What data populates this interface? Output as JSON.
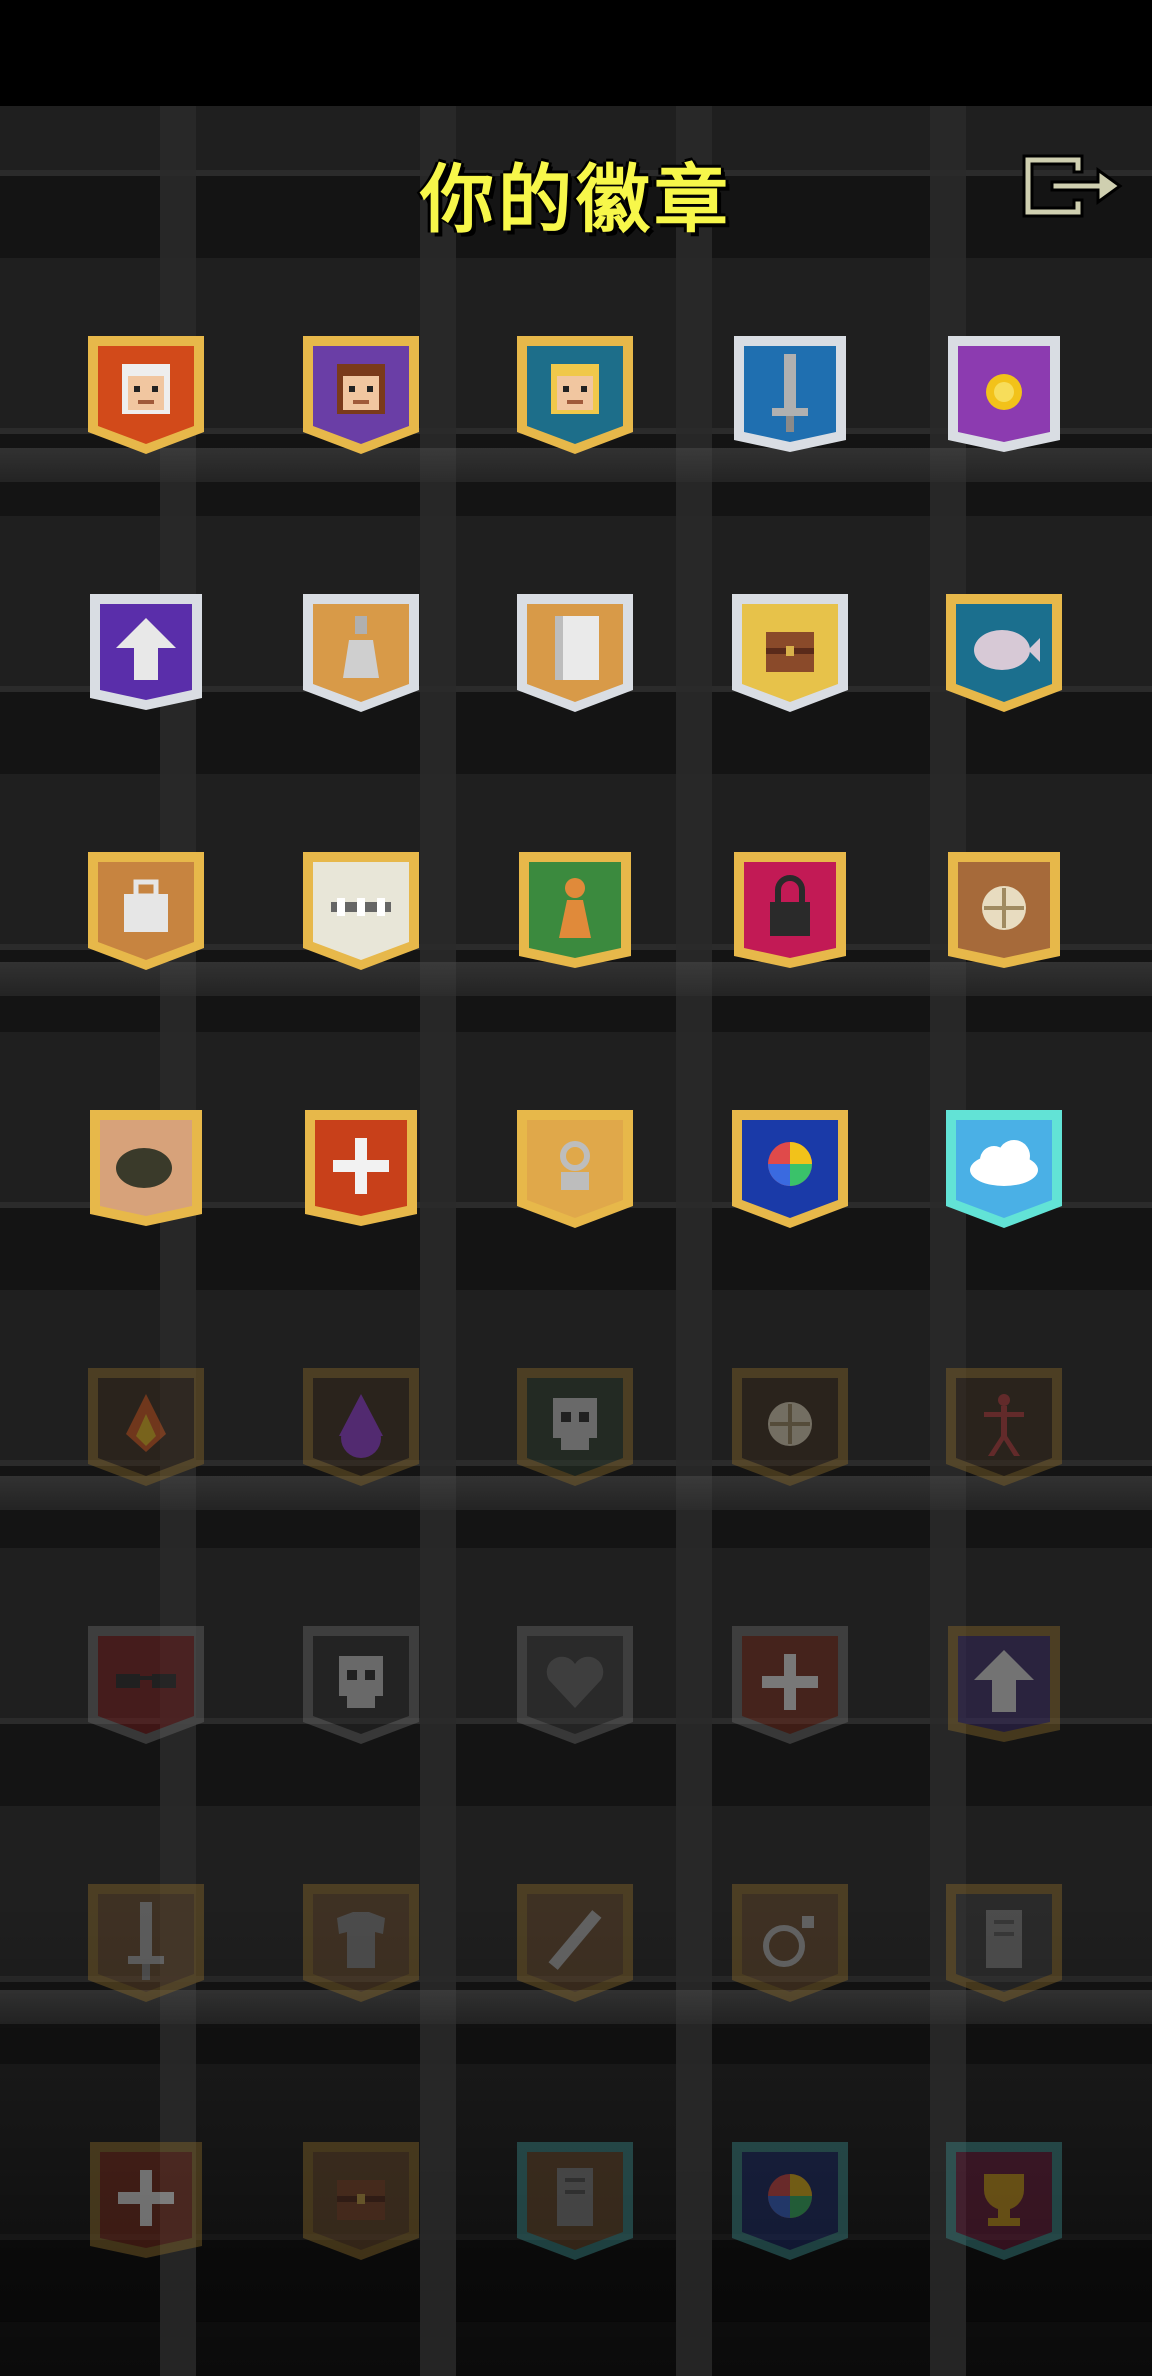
{
  "header": {
    "title": "你的徽章",
    "exit_icon": "exit-door-icon"
  },
  "colors": {
    "title": "#f7f74a",
    "background": "#111111"
  },
  "badges": [
    {
      "icon": "warrior-face-icon",
      "bg": "#d24a1a",
      "frame": "#e7b84a",
      "shape": "shield",
      "unlocked": true
    },
    {
      "icon": "mage-face-icon",
      "bg": "#6a3ea6",
      "frame": "#e7b84a",
      "shape": "shield",
      "unlocked": true
    },
    {
      "icon": "rogue-face-icon",
      "bg": "#1d6e8a",
      "frame": "#e7b84a",
      "shape": "shield",
      "unlocked": true
    },
    {
      "icon": "sword-icon",
      "bg": "#1f6fb0",
      "frame": "#d9dde3",
      "shape": "banner",
      "unlocked": true
    },
    {
      "icon": "gold-coin-icon",
      "bg": "#8c3bb0",
      "frame": "#d9dde3",
      "shape": "banner",
      "unlocked": true
    },
    {
      "icon": "up-arrow-icon",
      "bg": "#5a2eaa",
      "frame": "#d9dde3",
      "shape": "banner",
      "unlocked": true
    },
    {
      "icon": "potion-icon",
      "bg": "#d89a48",
      "frame": "#d9dde3",
      "shape": "shield",
      "unlocked": true
    },
    {
      "icon": "scroll-icon",
      "bg": "#d89a48",
      "frame": "#d9dde3",
      "shape": "shield",
      "unlocked": true
    },
    {
      "icon": "chest-icon",
      "bg": "#e7c24a",
      "frame": "#d9dde3",
      "shape": "shield",
      "unlocked": true
    },
    {
      "icon": "piranha-icon",
      "bg": "#1b6f8e",
      "frame": "#e7b84a",
      "shape": "shield",
      "unlocked": true
    },
    {
      "icon": "bag-icon",
      "bg": "#c78440",
      "frame": "#e7b84a",
      "shape": "shield",
      "unlocked": true
    },
    {
      "icon": "bones-icon",
      "bg": "#e8e6d8",
      "frame": "#e7b84a",
      "shape": "shield",
      "unlocked": true
    },
    {
      "icon": "pawn-icon",
      "bg": "#3b8a3e",
      "frame": "#e7b84a",
      "shape": "banner",
      "unlocked": true
    },
    {
      "icon": "padlock-icon",
      "bg": "#c21a55",
      "frame": "#e7b84a",
      "shape": "banner",
      "unlocked": true
    },
    {
      "icon": "food-icon",
      "bg": "#a66a3a",
      "frame": "#e7b84a",
      "shape": "banner",
      "unlocked": true
    },
    {
      "icon": "pot-icon",
      "bg": "#d7a27a",
      "frame": "#e7b84a",
      "shape": "banner",
      "unlocked": true
    },
    {
      "icon": "cross-icon",
      "bg": "#c8401a",
      "frame": "#e7b84a",
      "shape": "banner",
      "unlocked": true
    },
    {
      "icon": "ankh-icon",
      "bg": "#e0a84a",
      "frame": "#e7b84a",
      "shape": "shield",
      "unlocked": true
    },
    {
      "icon": "rainbow-orb-icon",
      "bg": "#1a3aa8",
      "frame": "#e7b84a",
      "shape": "shield",
      "unlocked": true
    },
    {
      "icon": "cloud-icon",
      "bg": "#4ab0e6",
      "frame": "#62e3d6",
      "shape": "shield",
      "unlocked": true
    },
    {
      "icon": "flame-icon",
      "bg": "#3a2a1a",
      "frame": "#8a6a2a",
      "shape": "shield",
      "unlocked": false
    },
    {
      "icon": "drop-icon",
      "bg": "#3a2a1a",
      "frame": "#8a6a2a",
      "shape": "shield",
      "unlocked": false
    },
    {
      "icon": "skull-icon",
      "bg": "#2a3a2a",
      "frame": "#8a6a2a",
      "shape": "shield",
      "unlocked": false
    },
    {
      "icon": "food-icon",
      "bg": "#3a2a1a",
      "frame": "#8a6a2a",
      "shape": "shield",
      "unlocked": false
    },
    {
      "icon": "figure-icon",
      "bg": "#3a2a1a",
      "frame": "#8a6a2a",
      "shape": "shield",
      "unlocked": false
    },
    {
      "icon": "glasses-icon",
      "bg": "#7a1a1a",
      "frame": "#6a6a6a",
      "shape": "shield",
      "unlocked": false
    },
    {
      "icon": "skull-icon",
      "bg": "#2a2a2a",
      "frame": "#6a6a6a",
      "shape": "shield",
      "unlocked": false
    },
    {
      "icon": "heart-icon",
      "bg": "#3a3a3a",
      "frame": "#6a6a6a",
      "shape": "shield",
      "unlocked": false
    },
    {
      "icon": "cross-icon",
      "bg": "#7a2a1a",
      "frame": "#6a6a6a",
      "shape": "shield",
      "unlocked": false
    },
    {
      "icon": "up-arrow-icon",
      "bg": "#3a2a6a",
      "frame": "#8a6a2a",
      "shape": "banner",
      "unlocked": false
    },
    {
      "icon": "sword-icon",
      "bg": "#6a4a2a",
      "frame": "#8a6a2a",
      "shape": "shield",
      "unlocked": false
    },
    {
      "icon": "armor-icon",
      "bg": "#6a4a2a",
      "frame": "#8a6a2a",
      "shape": "shield",
      "unlocked": false
    },
    {
      "icon": "wand-icon",
      "bg": "#6a4a2a",
      "frame": "#8a6a2a",
      "shape": "shield",
      "unlocked": false
    },
    {
      "icon": "ring-icon",
      "bg": "#6a4a2a",
      "frame": "#8a6a2a",
      "shape": "shield",
      "unlocked": false
    },
    {
      "icon": "tablet-icon",
      "bg": "#3a3a3a",
      "frame": "#8a6a2a",
      "shape": "shield",
      "unlocked": false
    },
    {
      "icon": "cross-icon",
      "bg": "#7a2a1a",
      "frame": "#8a6a2a",
      "shape": "banner",
      "unlocked": false
    },
    {
      "icon": "chest-icon",
      "bg": "#6a4a2a",
      "frame": "#8a6a2a",
      "shape": "shield",
      "unlocked": false
    },
    {
      "icon": "tablet-icon",
      "bg": "#6a4a2a",
      "frame": "#3a8a8a",
      "shape": "shield",
      "unlocked": false
    },
    {
      "icon": "rainbow-orb-icon",
      "bg": "#1a2a6a",
      "frame": "#3a8a8a",
      "shape": "shield",
      "unlocked": false
    },
    {
      "icon": "trophy-icon",
      "bg": "#6a1a3a",
      "frame": "#3a8a8a",
      "shape": "shield",
      "unlocked": false
    }
  ]
}
